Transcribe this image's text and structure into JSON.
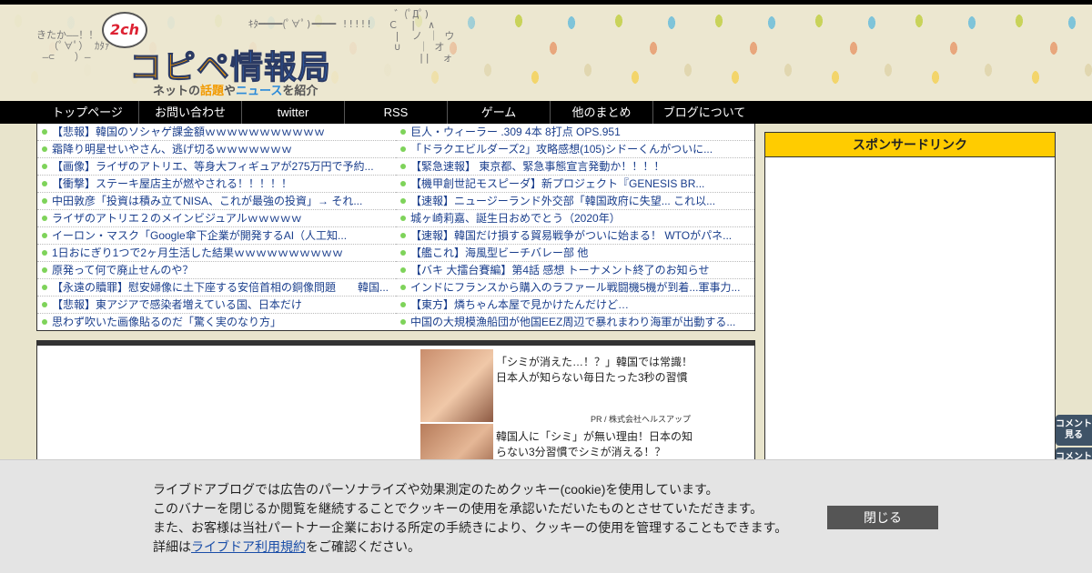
{
  "header": {
    "logo_badge": "2ch",
    "logo_title_a": "コピペ",
    "logo_title_b": "情報局",
    "tagline_a": "ネットの",
    "tagline_b": "話題",
    "tagline_c": "や",
    "tagline_d": "ニュース",
    "tagline_e": "を紹介"
  },
  "nav": {
    "items": [
      {
        "label": "トップページ"
      },
      {
        "label": "お問い合わせ"
      },
      {
        "label": "twitter"
      },
      {
        "label": "RSS"
      },
      {
        "label": "ゲーム"
      },
      {
        "label": "他のまとめ"
      },
      {
        "label": "ブログについて"
      }
    ]
  },
  "links": {
    "left": [
      "【悲報】韓国のソシャゲ課金額ｗｗｗｗｗｗｗｗｗｗｗ",
      "霜降り明星せいやさん、逃げ切るｗｗｗｗｗｗｗ",
      "【画像】ライザのアトリエ、等身大フィギュアが275万円で予約...",
      "【衝撃】ステーキ屋店主が燃やされる！！！！！",
      "中田敦彦「投資は積み立てNISA、これが最強の投資」→ それ...",
      "ライザのアトリエ２のメインビジュアルｗｗｗｗｗ",
      "イーロン・マスク「Google傘下企業が開発するAI（人工知...",
      "1日おにぎり1つで2ヶ月生活した結果ｗｗｗｗｗｗｗｗｗｗ",
      "原発って何で廃止せんのや？",
      "【永遠の贖罪】慰安婦像に土下座する安倍首相の銅像問題　　韓国...",
      "【悲報】東アジアで感染者増えている国、日本だけ",
      "思わず吹いた画像貼るのだ「驚く実のなり方」"
    ],
    "right": [
      "巨人・ウィーラー .309 4本 8打点 OPS.951",
      "「ドラクエビルダーズ2」攻略感想(105)シドーくんがついに...",
      "【緊急速報】 東京都、緊急事態宣言発動か！！！！",
      "【機甲創世記モスピーダ】新プロジェクト『GENESIS BR...",
      "【速報】ニュージーランド外交部「韓国政府に失望... これ以...",
      "城ヶ崎莉嘉、誕生日おめでとう（2020年）",
      "【速報】韓国だけ損する貿易戦争がついに始まる！ WTOがパネ...",
      "【艦これ】海風型ビーチバレー部 他",
      "【バキ 大擂台賽編】第4話 感想 トーナメント終了のお知らせ",
      "インドにフランスから購入のラファール戦闘機5機が到着...軍事力...",
      "【東方】燐ちゃん本屋で見かけたんだけど…",
      "中国の大規模漁船団が他国EEZ周辺で暴れまわり海軍が出動する..."
    ]
  },
  "sponsor": {
    "heading": "スポンサードリンク"
  },
  "ads": {
    "ad1_text": "「シミが消えた…！？」韓国では常識！日本人が知らない毎日たった3秒の習慣",
    "ad1_pr": "PR / 株式会社ヘルスアップ",
    "ad2_text": "韓国人に「シミ」が無い理由！日本の知らない3分習慣でシミが消える！？"
  },
  "side_buttons": {
    "comment_view": "コメント見る",
    "comment": "コメント"
  },
  "cookie": {
    "line1": "ライブドアブログでは広告のパーソナライズや効果測定のためクッキー(cookie)を使用しています。",
    "line2": "このバナーを閉じるか閲覧を継続することでクッキーの使用を承認いただいたものとさせていただきます。",
    "line3": "また、お客様は当社パートナー企業における所定の手続きにより、クッキーの使用を管理することもできます。",
    "line4_prefix": "詳細は",
    "line4_link": "ライブドア利用規約",
    "line4_suffix": "をご確認ください。",
    "close_label": "閉じる"
  }
}
